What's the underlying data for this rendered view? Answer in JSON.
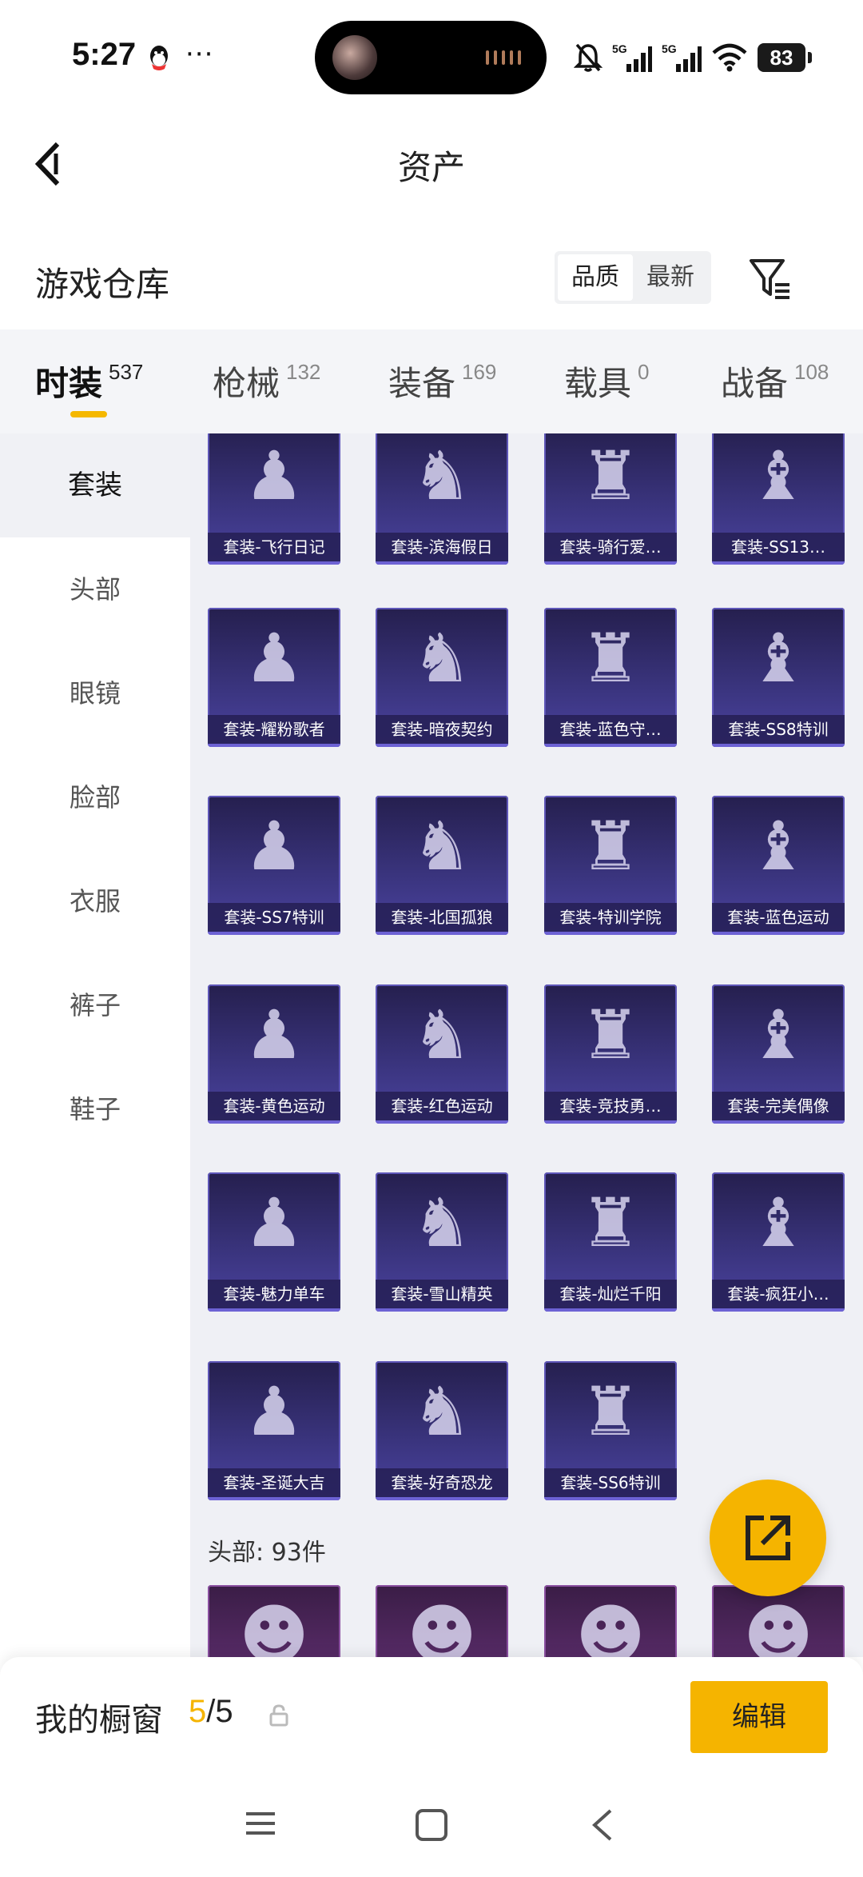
{
  "status_bar": {
    "time": "5:27",
    "more": "···",
    "battery": "83",
    "network_1": "5G",
    "network_2": "5G"
  },
  "header": {
    "title": "资产"
  },
  "warehouse": {
    "title": "游戏仓库",
    "sort_options": [
      "品质",
      "最新"
    ],
    "active_sort": "品质"
  },
  "tabs": [
    {
      "label": "时装",
      "count": "537",
      "active": true
    },
    {
      "label": "枪械",
      "count": "132",
      "active": false
    },
    {
      "label": "装备",
      "count": "169",
      "active": false
    },
    {
      "label": "载具",
      "count": "0",
      "active": false
    },
    {
      "label": "战备",
      "count": "108",
      "active": false
    }
  ],
  "sidebar": {
    "items": [
      "套装",
      "头部",
      "眼镜",
      "脸部",
      "衣服",
      "裤子",
      "鞋子"
    ],
    "active_index": 0
  },
  "items": [
    "套装-飞行日记",
    "套装-滨海假日",
    "套装-骑行爱…",
    "套装-SS13…",
    "套装-耀粉歌者",
    "套装-暗夜契约",
    "套装-蓝色守…",
    "套装-SS8特训",
    "套装-SS7特训",
    "套装-北国孤狼",
    "套装-特训学院",
    "套装-蓝色运动",
    "套装-黄色运动",
    "套装-红色运动",
    "套装-竞技勇…",
    "套装-完美偶像",
    "套装-魅力单车",
    "套装-雪山精英",
    "套装-灿烂千阳",
    "套装-疯狂小…",
    "套装-圣诞大吉",
    "套装-好奇恐龙",
    "套装-SS6特训"
  ],
  "head_section": {
    "label": "头部: 93件"
  },
  "showcase": {
    "title": "我的橱窗",
    "used": "5",
    "separator": "/",
    "total": "5",
    "edit_label": "编辑"
  },
  "colors": {
    "accent": "#f5b400",
    "card_bg": "#3b3580",
    "grid_bg": "#eff0f5"
  }
}
